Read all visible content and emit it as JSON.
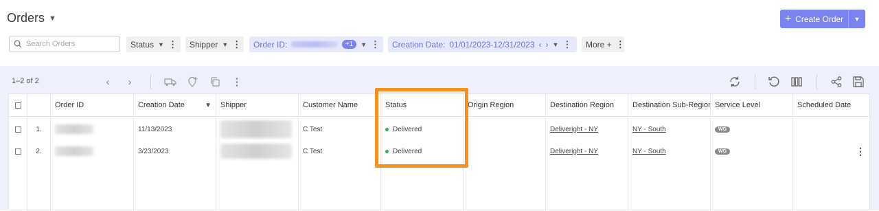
{
  "header": {
    "title": "Orders",
    "create_label": "Create Order"
  },
  "search": {
    "placeholder": "Search Orders",
    "value": ""
  },
  "filters": {
    "status": "Status",
    "shipper": "Shipper",
    "order_id_label": "Order ID:",
    "order_id_badge": "+1",
    "creation_date_label": "Creation Date:",
    "creation_date_value": "01/01/2023-12/31/2023",
    "more": "More +"
  },
  "toolbar": {
    "count": "1–2 of 2"
  },
  "table": {
    "columns": [
      "Order ID",
      "Creation Date",
      "Shipper",
      "Customer Name",
      "Status",
      "Origin Region",
      "Destination Region",
      "Destination Sub-Region",
      "Service Level",
      "Scheduled Date"
    ],
    "rows": [
      {
        "num": "1.",
        "creation_date": "11/13/2023",
        "customer": "C Test",
        "status": "Delivered",
        "dest_region": "Deliveright - NY",
        "dest_sub_region": "NY - South",
        "service_level": "WG"
      },
      {
        "num": "2.",
        "creation_date": "3/23/2023",
        "customer": "C Test",
        "status": "Delivered",
        "dest_region": "Deliveright - NY",
        "dest_sub_region": "NY - South",
        "service_level": "WG"
      }
    ]
  },
  "colors": {
    "accent": "#7b83f0",
    "highlight": "#f7911e",
    "delivered": "#27b34b"
  }
}
